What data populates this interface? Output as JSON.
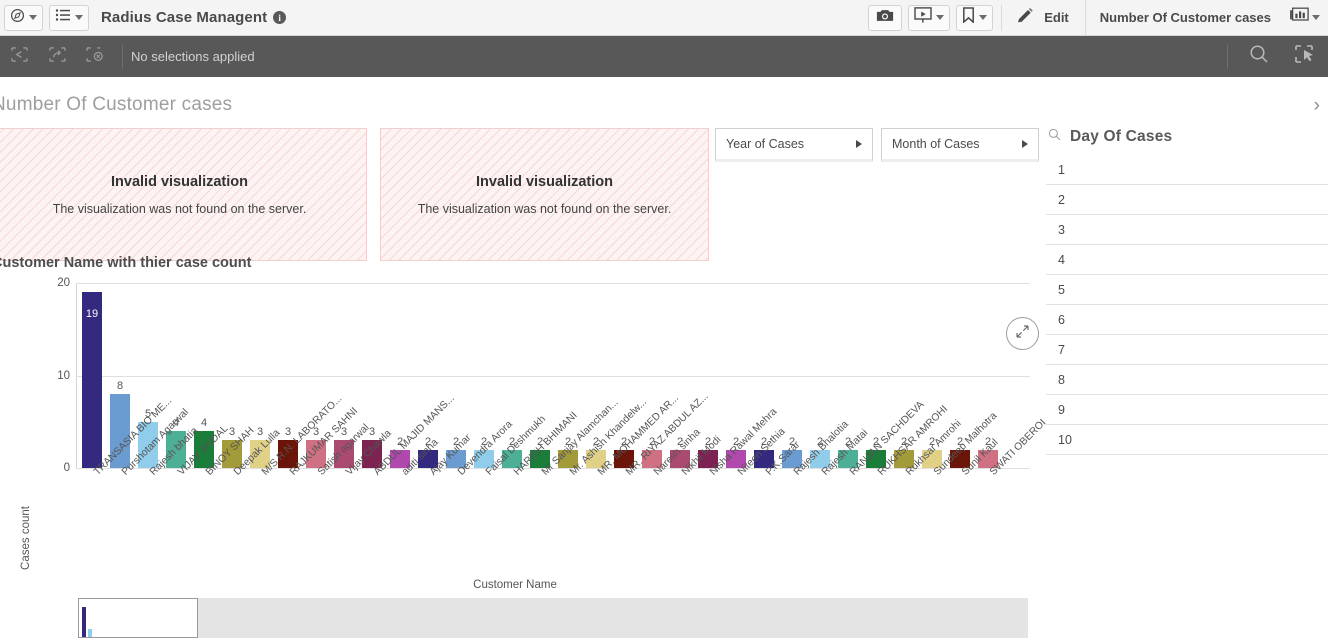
{
  "toolbar": {
    "nav_icon": "compass-icon",
    "sheets_icon": "list-icon",
    "app_title": "Radius Case Managent",
    "info_icon": "info-icon",
    "snapshot_icon": "camera-icon",
    "present_icon": "present-icon",
    "bookmark_icon": "bookmark-icon",
    "edit_icon": "pencil-icon",
    "edit_label": "Edit",
    "sheet_name": "Number Of Customer cases",
    "sheet_nav_icon": "sheet-grid-icon"
  },
  "selection_bar": {
    "back_icon": "selection-back-icon",
    "forward_icon": "selection-forward-icon",
    "clear_icon": "selection-clear-icon",
    "status_text": "No selections applied",
    "search_icon": "search-icon",
    "lasso_icon": "selection-tool-icon"
  },
  "sheet": {
    "title": "Number Of Customer cases",
    "collapse_icon": "chevron-right-icon"
  },
  "invalid_panels": [
    {
      "heading": "Invalid visualization",
      "message": "The visualization was not found on the server."
    },
    {
      "heading": "Invalid visualization",
      "message": "The visualization was not found on the server."
    }
  ],
  "filters": [
    {
      "label": "Year of Cases",
      "caret_icon": "triangle-right-icon"
    },
    {
      "label": "Month of Cases",
      "caret_icon": "triangle-right-icon"
    }
  ],
  "listbox": {
    "search_icon": "search-icon",
    "title": "Day Of Cases",
    "items": [
      "1",
      "2",
      "3",
      "4",
      "5",
      "6",
      "7",
      "8",
      "9",
      "10"
    ]
  },
  "expand_button": {
    "icon": "expand-arrows-icon"
  },
  "chart_data": {
    "type": "bar",
    "title": "Customer Name with thier case count",
    "xlabel": "Customer Name",
    "ylabel": "Cases count",
    "ylim": [
      0,
      20
    ],
    "yticks": [
      "0",
      "10",
      "20"
    ],
    "grid": true,
    "legend": "none",
    "categories": [
      "TRANSASIA BIO ME...",
      "Purshotam Agarwal",
      "Rajesh bhatia",
      "VIJAY JINDAL",
      "BINOY SHAH",
      "Deepak Lulla",
      "M/S R.N. LABORATO...",
      "RAJKUMAR SAHNI",
      "Satish agarwal",
      "Vijay Chawla",
      "ABDUL MAJID MANS...",
      "aditi sinha",
      "Ajay Kumar",
      "Devendra Arora",
      "Faisal Deshmukh",
      "HARISH BHIMANI",
      "Mr Sanjay Alamchan...",
      "Mr. Ashish Khandelw...",
      "MR. MOHAMMED AR...",
      "MR. RIYAZ ABDUL AZ...",
      "Naresh sinha",
      "Nikhil Modi",
      "Nisha Rawal Mehra",
      "Niteen Sethia",
      "P.K.Sarar",
      "Rajesh Bhalotia",
      "Rajesh Matai",
      "RANJAN SACHDEVA",
      "RUKHSAR AMROHI",
      "Rukhsar Amrohi",
      "Sundeep Malhotra",
      "Sunil Kaul",
      "SWATI OBEROI"
    ],
    "values": [
      19,
      8,
      5,
      4,
      4,
      3,
      3,
      3,
      3,
      3,
      3,
      2,
      2,
      2,
      2,
      2,
      2,
      2,
      2,
      2,
      2,
      2,
      2,
      2,
      2,
      2,
      2,
      2,
      2,
      2,
      2,
      2,
      2
    ],
    "colors": [
      "#332a80",
      "#6a9bd1",
      "#8fcdea",
      "#4caf96",
      "#1a7d3a",
      "#a39a3a",
      "#e0d186",
      "#6b1508",
      "#cf7083",
      "#ab4a70",
      "#7d2352",
      "#b048ae",
      "#332a80",
      "#6a9bd1",
      "#8fcdea",
      "#4caf96",
      "#1a7d3a",
      "#a39a3a",
      "#e0d186",
      "#6b1508",
      "#cf7083",
      "#ab4a70",
      "#7d2352",
      "#b048ae",
      "#332a80",
      "#6a9bd1",
      "#8fcdea",
      "#4caf96",
      "#1a7d3a",
      "#a39a3a",
      "#e0d186",
      "#6b1508",
      "#cf7083"
    ]
  },
  "scrollbar": {
    "handle_icon": "scroll-handle"
  },
  "theme": {
    "selection_bar_bg": "#585858",
    "toolbar_bg": "#f4f4f4",
    "invalid_bg": "#fdf3f3",
    "invalid_stripe": "#f6d7d7"
  }
}
